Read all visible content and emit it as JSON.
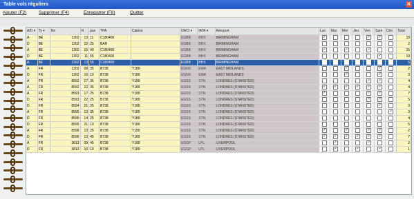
{
  "window": {
    "title": "Table vols réguliers",
    "close_symbol": "✕"
  },
  "menu": [
    "Ajouter (F2)",
    "Supprimer (F4)",
    "Enregistrer (F8)",
    "Quitter"
  ],
  "columns": [
    {
      "key": "code",
      "label": "A/D ▾"
    },
    {
      "key": "ty",
      "label": "Ty ▾"
    },
    {
      "key": "no",
      "label": "No"
    },
    {
      "key": "n",
      "label": "N"
    },
    {
      "key": "pn",
      "label": "pax"
    },
    {
      "key": "tpa",
      "label": "TPA"
    },
    {
      "key": "cab",
      "label": "Cabine"
    },
    {
      "key": "oaci",
      "label": "OACI ▾"
    },
    {
      "key": "iata",
      "label": "IATA ▾"
    },
    {
      "key": "apt",
      "label": "Aéroport"
    },
    {
      "key": "d1",
      "label": "Lun"
    },
    {
      "key": "d2",
      "label": "Mar"
    },
    {
      "key": "d3",
      "label": "Mer"
    },
    {
      "key": "d4",
      "label": "Jeu"
    },
    {
      "key": "d5",
      "label": "Ven"
    },
    {
      "key": "d6",
      "label": "Sam"
    },
    {
      "key": "d7",
      "label": "Dim"
    },
    {
      "key": "total",
      "label": "Total"
    }
  ],
  "rows": [
    {
      "code": "A",
      "ty": "BE",
      "no": "1302",
      "n": "13",
      "pn": "11",
      "tpa": "C180400",
      "cab": "",
      "oaci": "EGBB",
      "iata": "BHX",
      "apt": "BIRMINGHAM",
      "days": [
        1,
        0,
        0,
        0,
        1,
        1,
        0
      ],
      "total": "18"
    },
    {
      "code": "D",
      "ty": "BE",
      "no": "1302",
      "n": "15",
      "pn": "25",
      "tpa": "BAH",
      "cab": "",
      "oaci": "EGBB",
      "iata": "BHX",
      "apt": "BIRMINGHAM",
      "days": [
        0,
        0,
        0,
        0,
        0,
        0,
        0
      ],
      "total": "2"
    },
    {
      "code": "A",
      "ty": "BE",
      "no": "1302",
      "n": "15",
      "pn": "40",
      "tpa": "C180400",
      "cab": "",
      "oaci": "EGBB",
      "iata": "BHX",
      "apt": "BIRMINGHAM",
      "days": [
        1,
        0,
        1,
        0,
        1,
        0,
        0
      ],
      "total": "15"
    },
    {
      "code": "D",
      "ty": "BE",
      "no": "1302",
      "n": "11",
      "pn": "55",
      "tpa": "C180400",
      "cab": "",
      "oaci": "EGBB",
      "iata": "BHX",
      "apt": "BIRMINGHAM",
      "days": [
        0,
        0,
        0,
        0,
        0,
        1,
        0
      ],
      "total": "10"
    },
    {
      "code": "A",
      "ty": "BE",
      "no": "1302",
      "n": "13",
      "pn": "55",
      "tpa": "C180400",
      "cab": "",
      "oaci": "EGBB",
      "iata": "BHX",
      "apt": "BIRMINGHAM",
      "days": [
        0,
        0,
        0,
        0,
        0,
        0,
        0
      ],
      "total": "5",
      "selected": true
    },
    {
      "code": "A",
      "ty": "FR",
      "no": "1302",
      "n": "08",
      "pn": "35",
      "tpa": "B738",
      "cab": "Y189",
      "oaci": "EGNX",
      "iata": "EMA",
      "apt": "EAST MIDLANDS",
      "days": [
        0,
        0,
        1,
        0,
        0,
        1,
        0
      ],
      "total": "2"
    },
    {
      "code": "D",
      "ty": "FR",
      "no": "1302",
      "n": "16",
      "pn": "10",
      "tpa": "B738",
      "cab": "Y189",
      "oaci": "EGNX",
      "iata": "EMA",
      "apt": "EAST MIDLANDS",
      "days": [
        0,
        0,
        1,
        0,
        0,
        1,
        0
      ],
      "total": "3"
    },
    {
      "code": "A",
      "ty": "FR",
      "no": "8592",
      "n": "17",
      "pn": "35",
      "tpa": "B738",
      "cab": "Y189",
      "oaci": "EGSS",
      "iata": "STN",
      "apt": "LONDRES (STANSTED)",
      "days": [
        0,
        0,
        0,
        0,
        1,
        1,
        0
      ],
      "total": "4"
    },
    {
      "code": "A",
      "ty": "FR",
      "no": "8592",
      "n": "22",
      "pn": "35",
      "tpa": "B738",
      "cab": "Y189",
      "oaci": "EGSS",
      "iata": "STN",
      "apt": "LONDRES (STANSTED)",
      "days": [
        1,
        1,
        1,
        1,
        1,
        1,
        0
      ],
      "total": "4"
    },
    {
      "code": "A",
      "ty": "FR",
      "no": "8593",
      "n": "17",
      "pn": "25",
      "tpa": "B738",
      "cab": "Y189",
      "oaci": "EGSS",
      "iata": "STN",
      "apt": "LONDRES (STANSTED)",
      "days": [
        1,
        0,
        0,
        0,
        1,
        1,
        0
      ],
      "total": "7"
    },
    {
      "code": "D",
      "ty": "FR",
      "no": "8593",
      "n": "22",
      "pn": "25",
      "tpa": "B738",
      "cab": "Y189",
      "oaci": "EGSS",
      "iata": "STN",
      "apt": "LONDRES (STANSTED)",
      "days": [
        0,
        0,
        0,
        0,
        1,
        1,
        0
      ],
      "total": "5"
    },
    {
      "code": "D",
      "ty": "FR",
      "no": "8594",
      "n": "21",
      "pn": "25",
      "tpa": "B738",
      "cab": "Y189",
      "oaci": "EGSS",
      "iata": "STN",
      "apt": "LONDRES (STANSTED)",
      "days": [
        0,
        0,
        0,
        0,
        0,
        1,
        0
      ],
      "total": "3"
    },
    {
      "code": "A",
      "ty": "FR",
      "no": "8595",
      "n": "13",
      "pn": "35",
      "tpa": "B738",
      "cab": "Y189",
      "oaci": "EGSS",
      "iata": "STN",
      "apt": "LONDRES (STANSTED)",
      "days": [
        0,
        0,
        0,
        0,
        0,
        0,
        1
      ],
      "total": "3"
    },
    {
      "code": "D",
      "ty": "FR",
      "no": "8595",
      "n": "14",
      "pn": "25",
      "tpa": "B738",
      "cab": "Y189",
      "oaci": "EGSS",
      "iata": "STN",
      "apt": "LONDRES (STANSTED)",
      "days": [
        0,
        0,
        0,
        0,
        0,
        0,
        0
      ],
      "total": "4"
    },
    {
      "code": "D",
      "ty": "FR",
      "no": "8595",
      "n": "21",
      "pn": "10",
      "tpa": "B738",
      "cab": "Y189",
      "oaci": "EGSS",
      "iata": "STN",
      "apt": "LONDRES (STANSTED)",
      "days": [
        0,
        0,
        0,
        0,
        0,
        0,
        0
      ],
      "total": "5"
    },
    {
      "code": "A",
      "ty": "FR",
      "no": "8596",
      "n": "13",
      "pn": "25",
      "tpa": "B738",
      "cab": "Y189",
      "oaci": "EGSS",
      "iata": "STN",
      "apt": "LONDRES (STANSTED)",
      "days": [
        1,
        0,
        1,
        0,
        1,
        1,
        0
      ],
      "total": "2"
    },
    {
      "code": "D",
      "ty": "FR",
      "no": "8596",
      "n": "13",
      "pn": "45",
      "tpa": "B738",
      "cab": "Y189",
      "oaci": "EGSS",
      "iata": "STN",
      "apt": "LONDRES (STANSTED)",
      "days": [
        1,
        1,
        1,
        1,
        1,
        1,
        0
      ],
      "total": "7"
    },
    {
      "code": "A",
      "ty": "FR",
      "no": "3813",
      "n": "09",
      "pn": "45",
      "tpa": "B738",
      "cab": "Y189",
      "oaci": "EGGP",
      "iata": "LPL",
      "apt": "LIVERPOOL",
      "days": [
        0,
        1,
        0,
        0,
        1,
        0,
        0
      ],
      "total": "2"
    },
    {
      "code": "D",
      "ty": "FR",
      "no": "3813",
      "n": "10",
      "pn": "10",
      "tpa": "B738",
      "cab": "Y189",
      "oaci": "EGGP",
      "iata": "LPL",
      "apt": "LIVERPOOL",
      "days": [
        0,
        1,
        0,
        1,
        0,
        1,
        0
      ],
      "total": "1"
    }
  ]
}
